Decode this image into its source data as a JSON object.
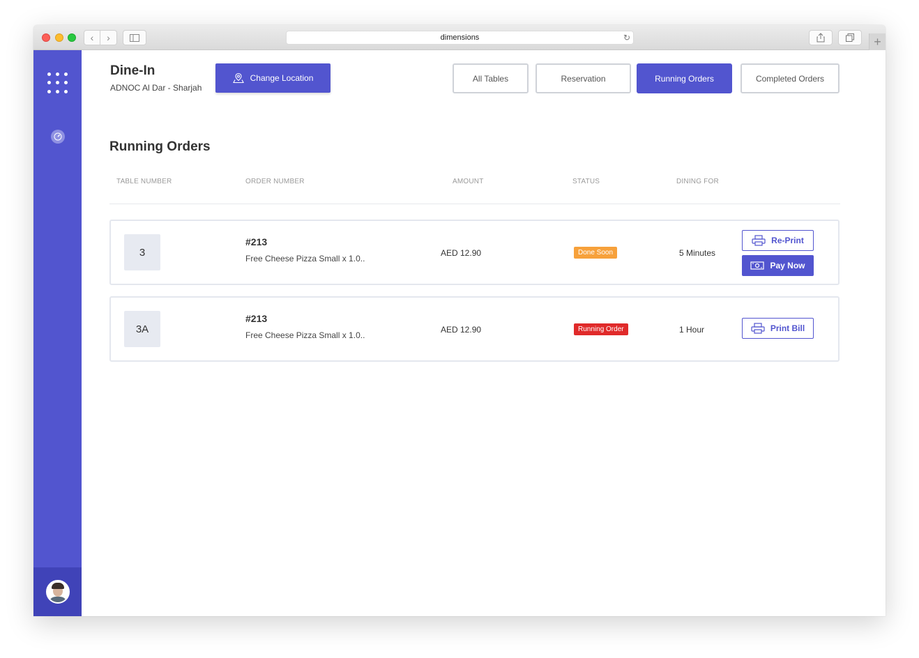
{
  "browser": {
    "url": "dimensions"
  },
  "header": {
    "title": "Dine-In",
    "location": "ADNOC Al Dar - Sharjah",
    "change_location_label": "Change Location"
  },
  "tabs": [
    {
      "label": "All Tables",
      "active": false
    },
    {
      "label": "Reservation",
      "active": false
    },
    {
      "label": "Running Orders",
      "active": true
    },
    {
      "label": "Completed Orders",
      "active": false
    }
  ],
  "section": {
    "title": "Running Orders",
    "columns": [
      "TABLE NUMBER",
      "ORDER NUMBER",
      "AMOUNT",
      "STATUS",
      "DINING FOR"
    ]
  },
  "orders": [
    {
      "table": "3",
      "order_number": "#213",
      "items": "Free Cheese Pizza Small x 1.0..",
      "amount": "AED 12.90",
      "status": "Done Soon",
      "status_color": "#f7a13b",
      "dining_for": "5 Minutes",
      "actions": [
        "Re-Print",
        "Pay Now"
      ]
    },
    {
      "table": "3A",
      "order_number": "#213",
      "items": "Free Cheese Pizza Small x 1.0..",
      "amount": "AED 12.90",
      "status": "Running Order",
      "status_color": "#e02a2a",
      "dining_for": "1 Hour",
      "actions": [
        "Print Bill"
      ]
    }
  ],
  "colors": {
    "accent": "#5255cf",
    "sidebar": "#5255cf"
  }
}
